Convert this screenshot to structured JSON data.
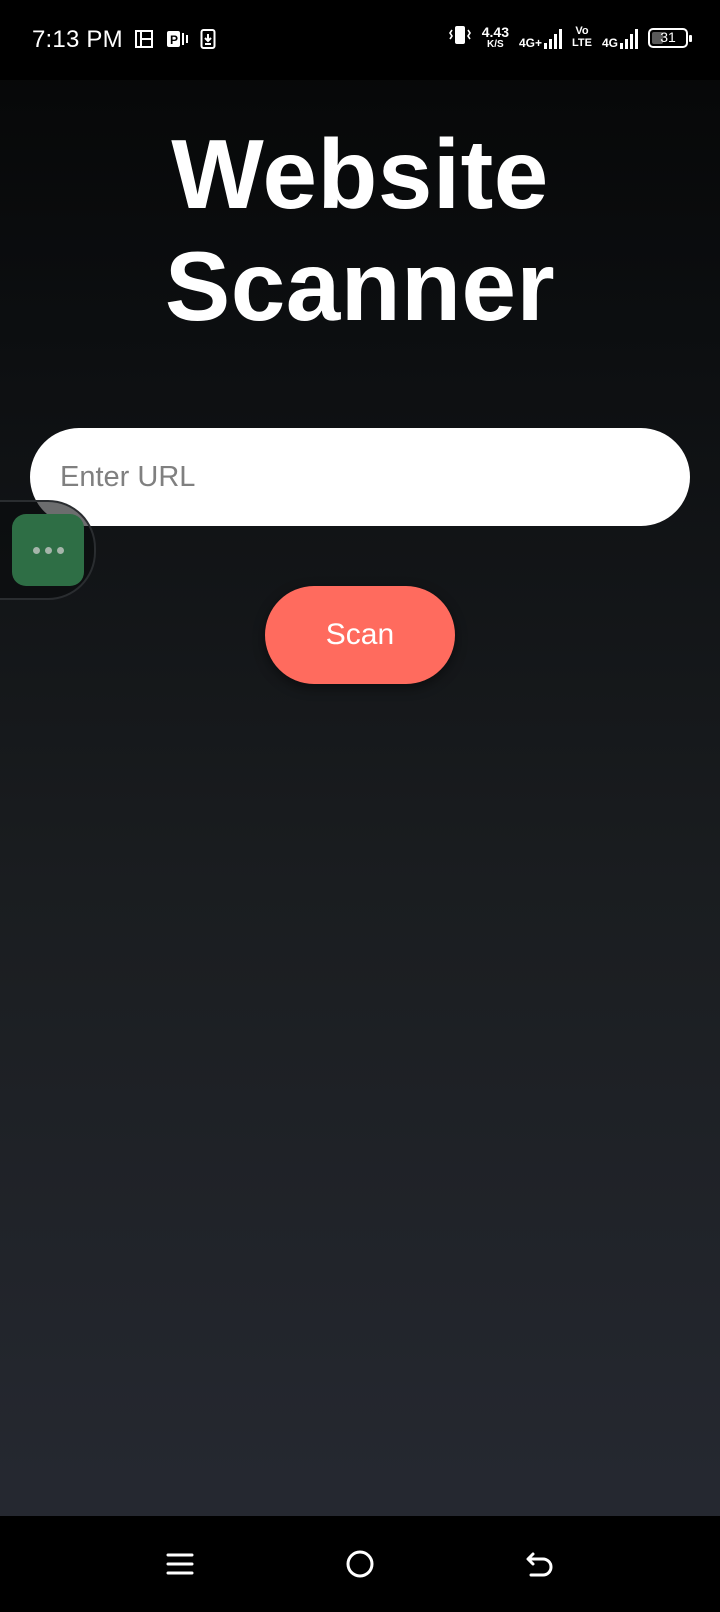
{
  "status_bar": {
    "time": "7:13 PM",
    "net_speed_value": "4.43",
    "net_speed_unit": "K/S",
    "net1_label": "4G+",
    "volte_top": "Vo",
    "volte_bottom": "LTE",
    "net2_label": "4G",
    "battery_level": "31",
    "icons": [
      "gallery-icon",
      "parking-icon",
      "download-icon",
      "vibrate-icon",
      "signal-icon",
      "battery-icon"
    ]
  },
  "app": {
    "title_line1": "Website",
    "title_line2": "Scanner",
    "url_input": {
      "placeholder": "Enter URL",
      "value": ""
    },
    "scan_label": "Scan"
  },
  "nav_bar": {
    "icons": [
      "menu-icon",
      "home-icon",
      "back-icon"
    ]
  },
  "colors": {
    "accent": "#ff6b5e",
    "bubble": "#2e6e45",
    "background_top": "#050606",
    "background_bottom": "#262932"
  }
}
